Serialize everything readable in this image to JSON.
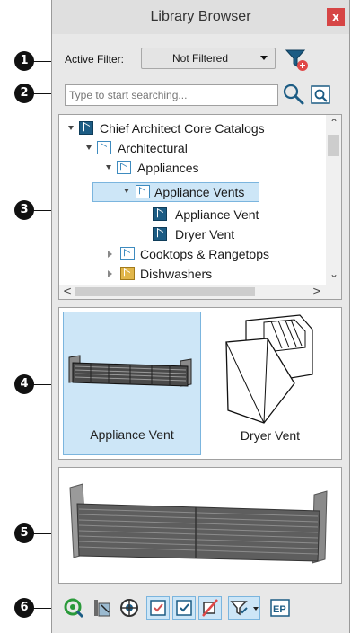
{
  "window": {
    "title": "Library Browser",
    "close_label": "x"
  },
  "filter": {
    "label": "Active Filter:",
    "value": "Not Filtered"
  },
  "search": {
    "placeholder": "Type to start searching..."
  },
  "tree": {
    "items": [
      {
        "label": "Chief Architect Core Catalogs",
        "icon": "catalog-book-icon",
        "expanded": true
      },
      {
        "label": "Architectural",
        "icon": "folder-icon",
        "expanded": true
      },
      {
        "label": "Appliances",
        "icon": "folder-icon",
        "expanded": true
      },
      {
        "label": "Appliance Vents",
        "icon": "folder-icon",
        "expanded": true,
        "selected": true
      },
      {
        "label": "Appliance Vent",
        "icon": "object-book-icon"
      },
      {
        "label": "Dryer Vent",
        "icon": "object-book-icon"
      },
      {
        "label": "Cooktops & Rangetops",
        "icon": "folder-icon",
        "expanded": false
      },
      {
        "label": "Dishwashers",
        "icon": "gold-folder-icon",
        "expanded": false
      }
    ]
  },
  "previews": [
    {
      "label": "Appliance Vent",
      "selected": true
    },
    {
      "label": "Dryer Vent",
      "selected": false
    }
  ],
  "callouts": [
    "1",
    "2",
    "3",
    "4",
    "5",
    "6"
  ],
  "toolbar": {
    "buttons": [
      "refresh-library-icon",
      "paint-palette-icon",
      "globe-settings-icon",
      "show-selected-icon",
      "filter-checkbox-icon",
      "no-material-icon",
      "filter-dropdown-icon",
      "ep-icon"
    ]
  },
  "colors": {
    "accent": "#cde6f7",
    "selection_border": "#7bb5de",
    "catalog_blue": "#1c5c84",
    "close_red": "#d64545"
  }
}
